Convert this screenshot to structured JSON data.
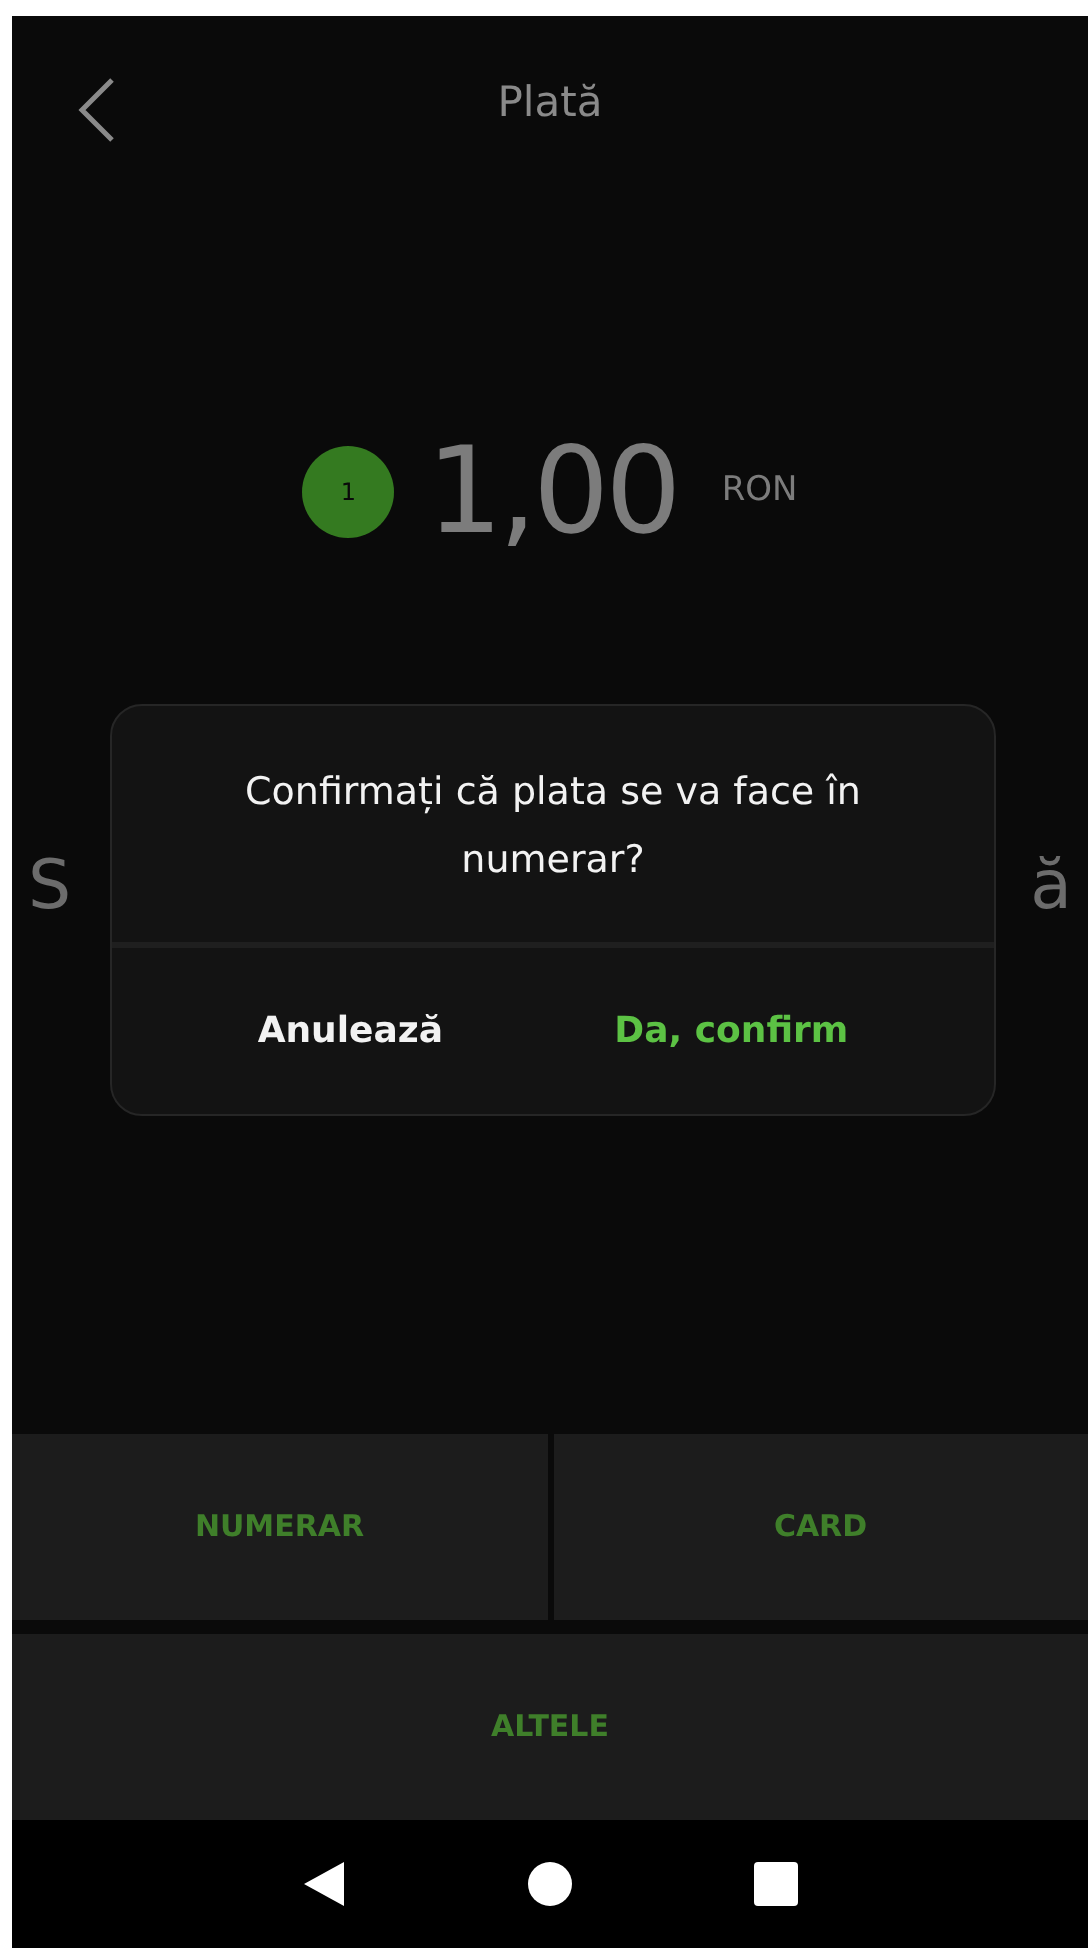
{
  "header": {
    "title": "Plată"
  },
  "amount": {
    "badge": "1",
    "value": "1,00",
    "currency": "RON"
  },
  "obscured_line": {
    "start": "S",
    "end": "ă"
  },
  "dialog": {
    "message": "Confirmați că plata se va face în numerar?",
    "buttons": [
      {
        "label": "Anulează",
        "kind": "cancel"
      },
      {
        "label": "Da, confirm",
        "kind": "confirm"
      }
    ]
  },
  "payment_rows": [
    [
      {
        "label": "NUMERAR"
      },
      {
        "label": "CARD"
      }
    ],
    [
      {
        "label": "ALTELE"
      }
    ]
  ]
}
